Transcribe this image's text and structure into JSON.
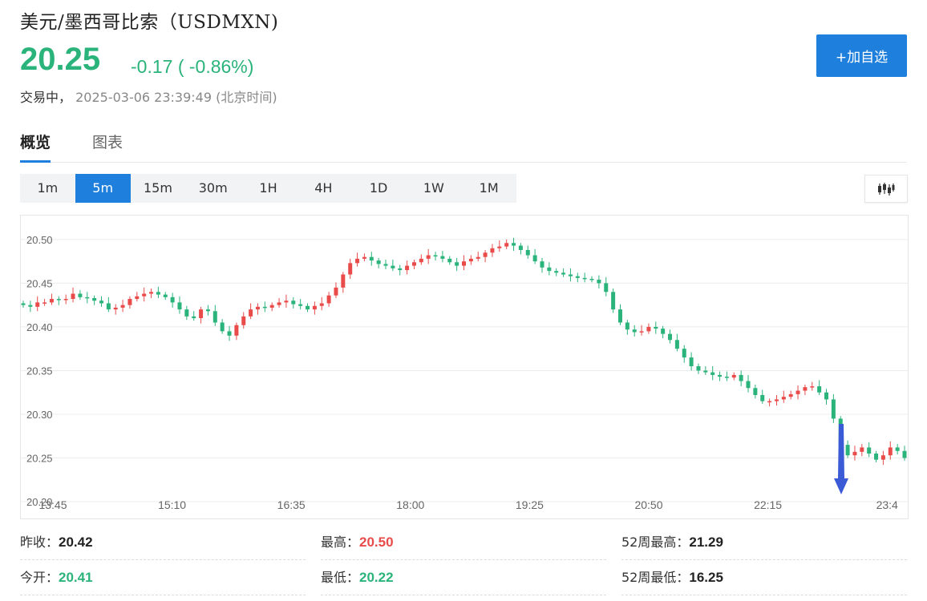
{
  "header": {
    "title": "美元/墨西哥比索（USDMXN)",
    "price": "20.25",
    "change": "-0.17 ( -0.86%)",
    "status_label": "交易中，",
    "timestamp": "2025-03-06 23:39:49",
    "timezone": "(北京时间)",
    "add_button": "+加自选"
  },
  "tabs": [
    {
      "label": "概览",
      "active": true
    },
    {
      "label": "图表",
      "active": false
    }
  ],
  "periods": [
    {
      "label": "1m",
      "active": false
    },
    {
      "label": "5m",
      "active": true
    },
    {
      "label": "15m",
      "active": false
    },
    {
      "label": "30m",
      "active": false
    },
    {
      "label": "1H",
      "active": false
    },
    {
      "label": "4H",
      "active": false
    },
    {
      "label": "1D",
      "active": false
    },
    {
      "label": "1W",
      "active": false
    },
    {
      "label": "1M",
      "active": false
    }
  ],
  "chart_toggle_icon": "candlestick-icon",
  "colors": {
    "up": "#e94b4b",
    "down": "#2ab37a",
    "accent": "#1e7fdc",
    "arrow": "#3b5bd6"
  },
  "chart_data": {
    "type": "candlestick",
    "y_ticks": [
      "20.50",
      "20.45",
      "20.40",
      "20.35",
      "20.30",
      "20.25",
      "20.20"
    ],
    "ylim": [
      20.2,
      20.51
    ],
    "x_ticks": [
      "13:45",
      "15:10",
      "16:35",
      "18:00",
      "19:25",
      "20:50",
      "22:15",
      "23:4"
    ],
    "grid": true,
    "annotation": "down-arrow",
    "closes": [
      20.425,
      20.423,
      20.428,
      20.428,
      20.432,
      20.431,
      20.432,
      20.438,
      20.434,
      20.433,
      20.43,
      20.427,
      20.42,
      20.422,
      20.425,
      20.432,
      20.435,
      20.438,
      20.44,
      20.437,
      20.434,
      20.428,
      20.42,
      20.412,
      20.41,
      20.42,
      20.418,
      20.405,
      20.395,
      20.39,
      20.402,
      20.412,
      20.42,
      20.423,
      20.422,
      20.425,
      20.428,
      20.43,
      20.426,
      20.424,
      20.42,
      20.424,
      20.427,
      20.436,
      20.445,
      20.46,
      20.473,
      20.478,
      20.48,
      20.476,
      20.472,
      20.47,
      20.467,
      20.465,
      20.47,
      20.474,
      20.478,
      20.482,
      20.481,
      20.478,
      20.474,
      20.47,
      20.475,
      20.478,
      20.48,
      20.485,
      20.49,
      20.492,
      20.496,
      20.493,
      20.488,
      20.482,
      20.475,
      20.468,
      20.464,
      20.462,
      20.46,
      20.458,
      20.456,
      20.455,
      20.454,
      20.45,
      20.44,
      20.42,
      20.405,
      20.397,
      20.394,
      20.395,
      20.4,
      20.398,
      20.392,
      20.385,
      20.375,
      20.365,
      20.355,
      20.35,
      20.348,
      20.345,
      20.343,
      20.342,
      20.345,
      20.338,
      20.33,
      20.322,
      20.315,
      20.315,
      20.317,
      20.32,
      20.323,
      20.327,
      20.331,
      20.332,
      20.325,
      20.317,
      20.295,
      20.265,
      20.253,
      20.257,
      20.262,
      20.255,
      20.248,
      20.253,
      20.262,
      20.258,
      20.25
    ]
  },
  "stats": [
    {
      "label": "昨收：",
      "value": "20.42",
      "tone": "neutral"
    },
    {
      "label": "最高：",
      "value": "20.50",
      "tone": "up"
    },
    {
      "label": "52周最高：",
      "value": "21.29",
      "tone": "neutral"
    },
    {
      "label": "今开：",
      "value": "20.41",
      "tone": "down"
    },
    {
      "label": "最低：",
      "value": "20.22",
      "tone": "down"
    },
    {
      "label": "52周最低：",
      "value": "16.25",
      "tone": "neutral"
    }
  ]
}
